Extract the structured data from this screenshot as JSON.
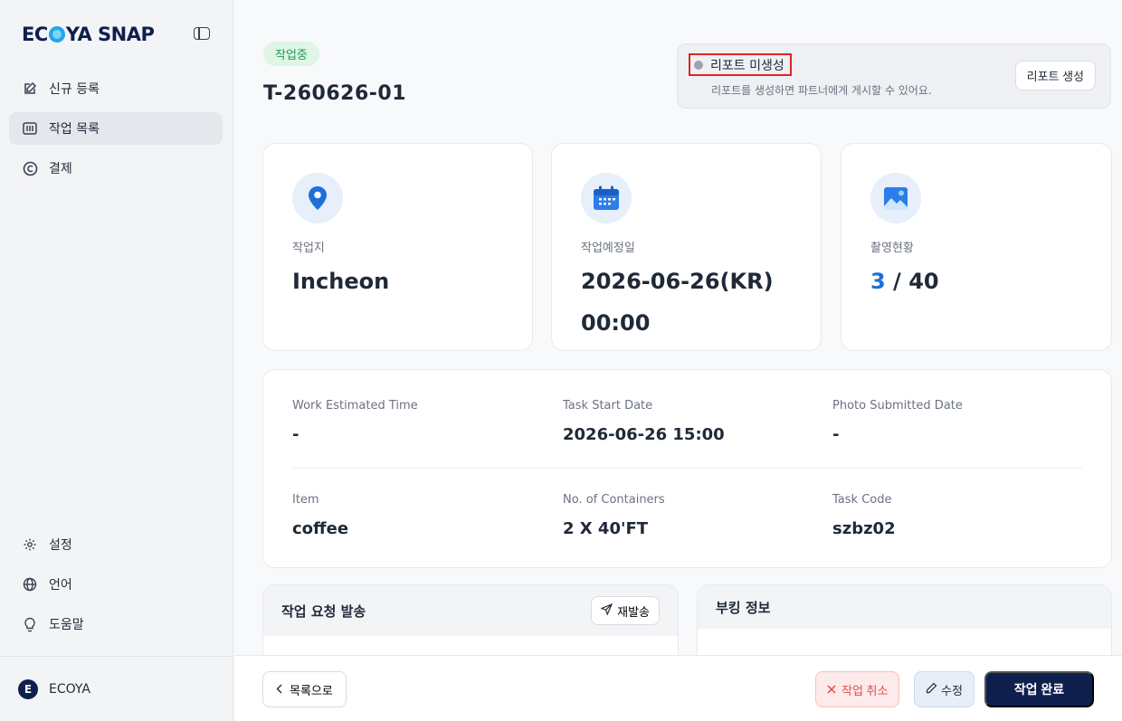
{
  "sidebar": {
    "brand": {
      "pre": "EC",
      "post": "YA SNAP"
    },
    "nav_top": [
      {
        "label": "신규 등록",
        "icon": "edit-icon"
      },
      {
        "label": "작업 목록",
        "icon": "list-icon",
        "active": true
      },
      {
        "label": "결제",
        "icon": "copyright-icon"
      }
    ],
    "nav_bottom": [
      {
        "label": "설정",
        "icon": "gear-icon"
      },
      {
        "label": "언어",
        "icon": "globe-icon"
      },
      {
        "label": "도움말",
        "icon": "lightbulb-icon"
      }
    ],
    "user": {
      "initial": "E",
      "name": "ECOYA"
    }
  },
  "header": {
    "status": "작업중",
    "task_id": "T-260626-01"
  },
  "report": {
    "status": "리포트 미생성",
    "description": "리포트를 생성하면 파트너에게 게시할 수 있어요.",
    "button": "리포트 생성"
  },
  "stats": {
    "location": {
      "label": "작업지",
      "value": "Incheon"
    },
    "schedule": {
      "label": "작업예정일",
      "date": "2026-06-26(KR)",
      "time": "00:00"
    },
    "photos": {
      "label": "촬영현황",
      "current": "3",
      "separator": " / ",
      "total": "40"
    }
  },
  "info": {
    "work_time": {
      "label": "Work Estimated Time",
      "value": "-"
    },
    "start_date": {
      "label": "Task Start Date",
      "value": "2026-06-26 15:00"
    },
    "photo_date": {
      "label": "Photo Submitted Date",
      "value": "-"
    },
    "item": {
      "label": "Item",
      "value": "coffee"
    },
    "containers": {
      "label": "No. of Containers",
      "value": "2 X 40'FT"
    },
    "task_code": {
      "label": "Task Code",
      "value": "szbz02"
    }
  },
  "panels": {
    "request": {
      "title": "작업 요청 발송",
      "resend": "재발송"
    },
    "booking": {
      "title": "부킹 정보"
    }
  },
  "footer": {
    "back": "목록으로",
    "cancel": "작업 취소",
    "edit": "수정",
    "complete": "작업 완료"
  },
  "colors": {
    "brand_navy": "#0f1f4d",
    "accent_blue": "#1e6fd9",
    "status_green": "#1f9d55",
    "danger": "#e24c4c"
  }
}
